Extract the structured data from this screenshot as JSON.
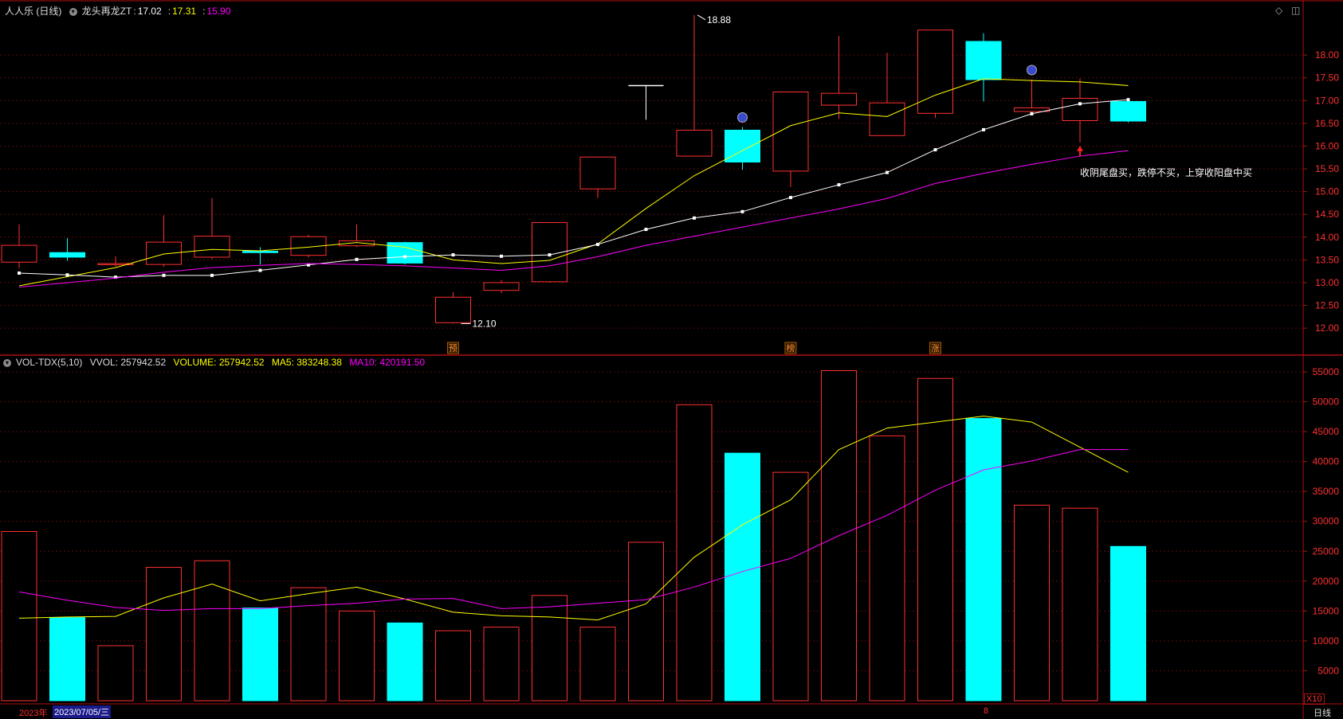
{
  "stock": {
    "name": "人人乐 (日线)"
  },
  "price_header": {
    "indicator": "龙头再龙ZT",
    "v1": "17.02",
    "v2": "17.31",
    "v3": "15.90"
  },
  "volume_header": {
    "indicator": "VOL-TDX(5,10)",
    "vvol": "VVOL: 257942.52",
    "volume": "VOLUME: 257942.52",
    "ma5": "MA5: 383248.38",
    "ma10": "MA10: 420191.50"
  },
  "annotation": "收阴尾盘买，跌停不买，上穿收阳盘中买",
  "markers": {
    "high_label": "18.88",
    "low_label": "12.10"
  },
  "day_markers": [
    {
      "index": 9,
      "text": "预"
    },
    {
      "index": 16,
      "text": "榜"
    },
    {
      "index": 19,
      "text": "涨"
    }
  ],
  "footer": {
    "year": "2023年",
    "date": "2023/07/05/三",
    "month_mark": "8",
    "period": "日线",
    "zoom": "X10"
  },
  "colors": {
    "up": "#ff3030",
    "down": "#00ffff",
    "ma_yellow": "#ffff00",
    "ma_white": "#ffffff",
    "ma_magenta": "#ff00ff",
    "axis": "#b01010"
  },
  "chart_data": [
    {
      "type": "candlestick",
      "title": "人人乐 (日线)",
      "ylim": [
        11.6,
        19.0
      ],
      "ticks": [
        12.0,
        12.5,
        13.0,
        13.5,
        14.0,
        14.5,
        15.0,
        15.5,
        16.0,
        16.5,
        17.0,
        17.5,
        18.0
      ],
      "candles": [
        {
          "o": 13.45,
          "c": 13.82,
          "h": 14.28,
          "l": 13.32
        },
        {
          "o": 13.66,
          "c": 13.56,
          "h": 13.98,
          "l": 13.48
        },
        {
          "o": 13.4,
          "c": 13.42,
          "h": 13.58,
          "l": 13.35
        },
        {
          "o": 13.4,
          "c": 13.89,
          "h": 14.48,
          "l": 13.35
        },
        {
          "o": 13.56,
          "c": 14.02,
          "h": 14.86,
          "l": 13.52
        },
        {
          "o": 13.69,
          "c": 13.66,
          "h": 13.78,
          "l": 13.4
        },
        {
          "o": 13.6,
          "c": 14.01,
          "h": 14.05,
          "l": 13.55
        },
        {
          "o": 13.81,
          "c": 13.92,
          "h": 14.28,
          "l": 13.78
        },
        {
          "o": 13.88,
          "c": 13.43,
          "h": 13.9,
          "l": 13.4
        },
        {
          "o": 12.12,
          "c": 12.68,
          "h": 12.79,
          "l": 12.1
        },
        {
          "o": 12.83,
          "c": 13.0,
          "h": 13.06,
          "l": 12.77
        },
        {
          "o": 13.02,
          "c": 14.32,
          "h": 14.32,
          "l": 13.0
        },
        {
          "o": 15.06,
          "c": 15.76,
          "h": 15.76,
          "l": 14.86
        },
        {
          "o": 17.33,
          "c": 17.33,
          "h": 17.33,
          "l": 16.58
        },
        {
          "o": 15.78,
          "c": 16.35,
          "h": 18.88,
          "l": 15.78
        },
        {
          "o": 16.35,
          "c": 15.65,
          "h": 16.42,
          "l": 15.48
        },
        {
          "o": 15.45,
          "c": 17.19,
          "h": 17.19,
          "l": 15.1
        },
        {
          "o": 16.9,
          "c": 17.16,
          "h": 18.42,
          "l": 16.6
        },
        {
          "o": 16.23,
          "c": 16.95,
          "h": 18.05,
          "l": 16.23
        },
        {
          "o": 16.72,
          "c": 18.55,
          "h": 18.55,
          "l": 16.62
        },
        {
          "o": 18.3,
          "c": 17.46,
          "h": 18.48,
          "l": 16.98
        },
        {
          "o": 16.76,
          "c": 16.84,
          "h": 17.46,
          "l": 16.7
        },
        {
          "o": 16.56,
          "c": 17.05,
          "h": 17.48,
          "l": 16.08
        },
        {
          "o": 16.98,
          "c": 16.55,
          "h": 17.04,
          "l": 16.52
        }
      ],
      "series": [
        {
          "color": "ma_yellow",
          "values": [
            12.93,
            13.13,
            13.33,
            13.63,
            13.73,
            13.7,
            13.78,
            13.88,
            13.78,
            13.5,
            13.42,
            13.49,
            13.85,
            14.63,
            15.35,
            15.9,
            16.45,
            16.73,
            16.65,
            17.12,
            17.48,
            17.44,
            17.41,
            17.33
          ]
        },
        {
          "color": "ma_white",
          "values": [
            13.21,
            13.17,
            13.12,
            13.16,
            13.16,
            13.27,
            13.39,
            13.51,
            13.57,
            13.61,
            13.58,
            13.61,
            13.84,
            14.17,
            14.42,
            14.56,
            14.87,
            15.15,
            15.42,
            15.92,
            16.36,
            16.71,
            16.93,
            17.02
          ]
        },
        {
          "color": "ma_magenta",
          "values": [
            12.9,
            13.0,
            13.1,
            13.23,
            13.33,
            13.38,
            13.42,
            13.4,
            13.37,
            13.32,
            13.27,
            13.37,
            13.57,
            13.82,
            14.02,
            14.22,
            14.42,
            14.62,
            14.85,
            15.18,
            15.4,
            15.6,
            15.78,
            15.9
          ]
        }
      ]
    },
    {
      "type": "bar",
      "title": "VOL-TDX(5,10)",
      "ylim": [
        0,
        56200
      ],
      "ticks": [
        5000,
        10000,
        15000,
        20000,
        25000,
        30000,
        35000,
        40000,
        45000,
        50000,
        55000
      ],
      "values": [
        28300,
        13900,
        9200,
        22300,
        23400,
        15500,
        18900,
        15000,
        13000,
        11700,
        12300,
        17600,
        12300,
        26500,
        49500,
        41400,
        38200,
        55200,
        44300,
        53900,
        47200,
        32700,
        32200,
        25800
      ],
      "direction": [
        "up",
        "down",
        "up",
        "up",
        "up",
        "down",
        "up",
        "up",
        "down",
        "up",
        "up",
        "up",
        "up",
        "up",
        "up",
        "down",
        "up",
        "up",
        "up",
        "up",
        "down",
        "up",
        "up",
        "down"
      ],
      "series": [
        {
          "color": "ma_yellow",
          "values": [
            13800,
            14000,
            14100,
            17200,
            19500,
            16700,
            17900,
            19000,
            17000,
            14800,
            14200,
            14000,
            13500,
            16200,
            24000,
            29400,
            33600,
            42000,
            45600,
            46600,
            47600,
            46600,
            null,
            38200
          ]
        },
        {
          "color": "ma_magenta",
          "values": [
            18200,
            16800,
            15600,
            15100,
            15400,
            15400,
            15900,
            16300,
            17000,
            17100,
            15400,
            15700,
            16300,
            16900,
            19000,
            21600,
            23800,
            27600,
            31000,
            35200,
            38600,
            40100,
            42000,
            42000
          ]
        }
      ]
    }
  ]
}
